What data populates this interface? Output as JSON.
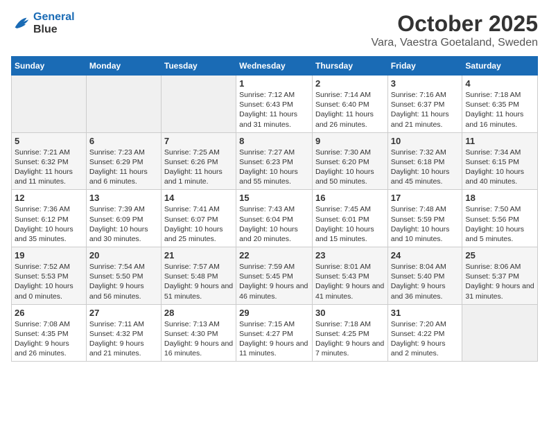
{
  "header": {
    "logo_line1": "General",
    "logo_line2": "Blue",
    "title": "October 2025",
    "subtitle": "Vara, Vaestra Goetaland, Sweden"
  },
  "weekdays": [
    "Sunday",
    "Monday",
    "Tuesday",
    "Wednesday",
    "Thursday",
    "Friday",
    "Saturday"
  ],
  "weeks": [
    [
      {
        "day": "",
        "info": ""
      },
      {
        "day": "",
        "info": ""
      },
      {
        "day": "",
        "info": ""
      },
      {
        "day": "1",
        "info": "Sunrise: 7:12 AM\nSunset: 6:43 PM\nDaylight: 11 hours and 31 minutes."
      },
      {
        "day": "2",
        "info": "Sunrise: 7:14 AM\nSunset: 6:40 PM\nDaylight: 11 hours and 26 minutes."
      },
      {
        "day": "3",
        "info": "Sunrise: 7:16 AM\nSunset: 6:37 PM\nDaylight: 11 hours and 21 minutes."
      },
      {
        "day": "4",
        "info": "Sunrise: 7:18 AM\nSunset: 6:35 PM\nDaylight: 11 hours and 16 minutes."
      }
    ],
    [
      {
        "day": "5",
        "info": "Sunrise: 7:21 AM\nSunset: 6:32 PM\nDaylight: 11 hours and 11 minutes."
      },
      {
        "day": "6",
        "info": "Sunrise: 7:23 AM\nSunset: 6:29 PM\nDaylight: 11 hours and 6 minutes."
      },
      {
        "day": "7",
        "info": "Sunrise: 7:25 AM\nSunset: 6:26 PM\nDaylight: 11 hours and 1 minute."
      },
      {
        "day": "8",
        "info": "Sunrise: 7:27 AM\nSunset: 6:23 PM\nDaylight: 10 hours and 55 minutes."
      },
      {
        "day": "9",
        "info": "Sunrise: 7:30 AM\nSunset: 6:20 PM\nDaylight: 10 hours and 50 minutes."
      },
      {
        "day": "10",
        "info": "Sunrise: 7:32 AM\nSunset: 6:18 PM\nDaylight: 10 hours and 45 minutes."
      },
      {
        "day": "11",
        "info": "Sunrise: 7:34 AM\nSunset: 6:15 PM\nDaylight: 10 hours and 40 minutes."
      }
    ],
    [
      {
        "day": "12",
        "info": "Sunrise: 7:36 AM\nSunset: 6:12 PM\nDaylight: 10 hours and 35 minutes."
      },
      {
        "day": "13",
        "info": "Sunrise: 7:39 AM\nSunset: 6:09 PM\nDaylight: 10 hours and 30 minutes."
      },
      {
        "day": "14",
        "info": "Sunrise: 7:41 AM\nSunset: 6:07 PM\nDaylight: 10 hours and 25 minutes."
      },
      {
        "day": "15",
        "info": "Sunrise: 7:43 AM\nSunset: 6:04 PM\nDaylight: 10 hours and 20 minutes."
      },
      {
        "day": "16",
        "info": "Sunrise: 7:45 AM\nSunset: 6:01 PM\nDaylight: 10 hours and 15 minutes."
      },
      {
        "day": "17",
        "info": "Sunrise: 7:48 AM\nSunset: 5:59 PM\nDaylight: 10 hours and 10 minutes."
      },
      {
        "day": "18",
        "info": "Sunrise: 7:50 AM\nSunset: 5:56 PM\nDaylight: 10 hours and 5 minutes."
      }
    ],
    [
      {
        "day": "19",
        "info": "Sunrise: 7:52 AM\nSunset: 5:53 PM\nDaylight: 10 hours and 0 minutes."
      },
      {
        "day": "20",
        "info": "Sunrise: 7:54 AM\nSunset: 5:50 PM\nDaylight: 9 hours and 56 minutes."
      },
      {
        "day": "21",
        "info": "Sunrise: 7:57 AM\nSunset: 5:48 PM\nDaylight: 9 hours and 51 minutes."
      },
      {
        "day": "22",
        "info": "Sunrise: 7:59 AM\nSunset: 5:45 PM\nDaylight: 9 hours and 46 minutes."
      },
      {
        "day": "23",
        "info": "Sunrise: 8:01 AM\nSunset: 5:43 PM\nDaylight: 9 hours and 41 minutes."
      },
      {
        "day": "24",
        "info": "Sunrise: 8:04 AM\nSunset: 5:40 PM\nDaylight: 9 hours and 36 minutes."
      },
      {
        "day": "25",
        "info": "Sunrise: 8:06 AM\nSunset: 5:37 PM\nDaylight: 9 hours and 31 minutes."
      }
    ],
    [
      {
        "day": "26",
        "info": "Sunrise: 7:08 AM\nSunset: 4:35 PM\nDaylight: 9 hours and 26 minutes."
      },
      {
        "day": "27",
        "info": "Sunrise: 7:11 AM\nSunset: 4:32 PM\nDaylight: 9 hours and 21 minutes."
      },
      {
        "day": "28",
        "info": "Sunrise: 7:13 AM\nSunset: 4:30 PM\nDaylight: 9 hours and 16 minutes."
      },
      {
        "day": "29",
        "info": "Sunrise: 7:15 AM\nSunset: 4:27 PM\nDaylight: 9 hours and 11 minutes."
      },
      {
        "day": "30",
        "info": "Sunrise: 7:18 AM\nSunset: 4:25 PM\nDaylight: 9 hours and 7 minutes."
      },
      {
        "day": "31",
        "info": "Sunrise: 7:20 AM\nSunset: 4:22 PM\nDaylight: 9 hours and 2 minutes."
      },
      {
        "day": "",
        "info": ""
      }
    ]
  ]
}
